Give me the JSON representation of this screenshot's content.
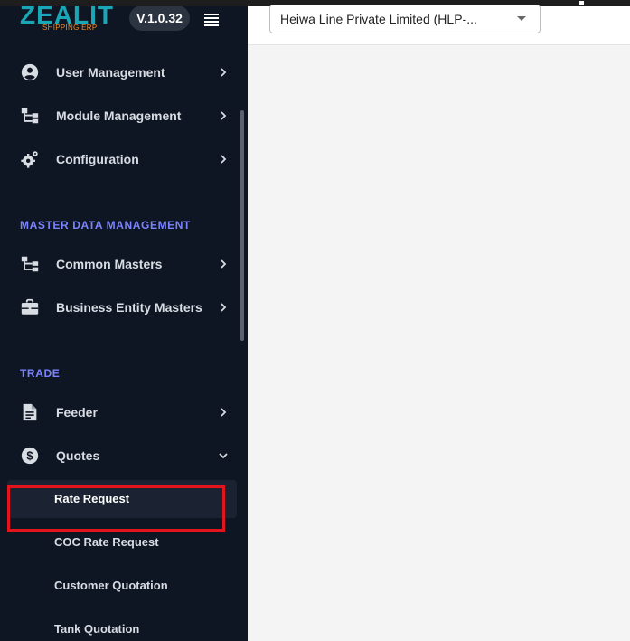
{
  "brand": {
    "logo_text": "ZEALIT",
    "logo_subtitle": "SHIPPING ERP",
    "version": "V.1.0.32"
  },
  "header": {
    "company_selected": "Heiwa Line Private Limited  (HLP-..."
  },
  "sidebar": {
    "items": [
      {
        "label": "User Management",
        "icon": "user-circle-icon"
      },
      {
        "label": "Module Management",
        "icon": "sitemap-icon"
      },
      {
        "label": "Configuration",
        "icon": "gears-icon"
      }
    ],
    "sections": [
      {
        "title": "MASTER DATA MANAGEMENT",
        "items": [
          {
            "label": "Common Masters",
            "icon": "sitemap-icon"
          },
          {
            "label": "Business Entity Masters",
            "icon": "briefcase-icon"
          }
        ]
      },
      {
        "title": "TRADE",
        "items": [
          {
            "label": "Feeder",
            "icon": "document-icon"
          },
          {
            "label": "Quotes",
            "icon": "dollar-circle-icon",
            "expanded": true
          }
        ]
      }
    ],
    "quotes_submenu": [
      {
        "label": "Rate Request",
        "active": true
      },
      {
        "label": "COC Rate Request"
      },
      {
        "label": "Customer Quotation"
      },
      {
        "label": "Tank Quotation"
      }
    ]
  },
  "colors": {
    "sidebar_bg": "#0f1623",
    "section_title": "#7b83ff",
    "highlight": "#e3141b",
    "logo_primary": "#19a7b7",
    "logo_secondary": "#f08a24"
  }
}
